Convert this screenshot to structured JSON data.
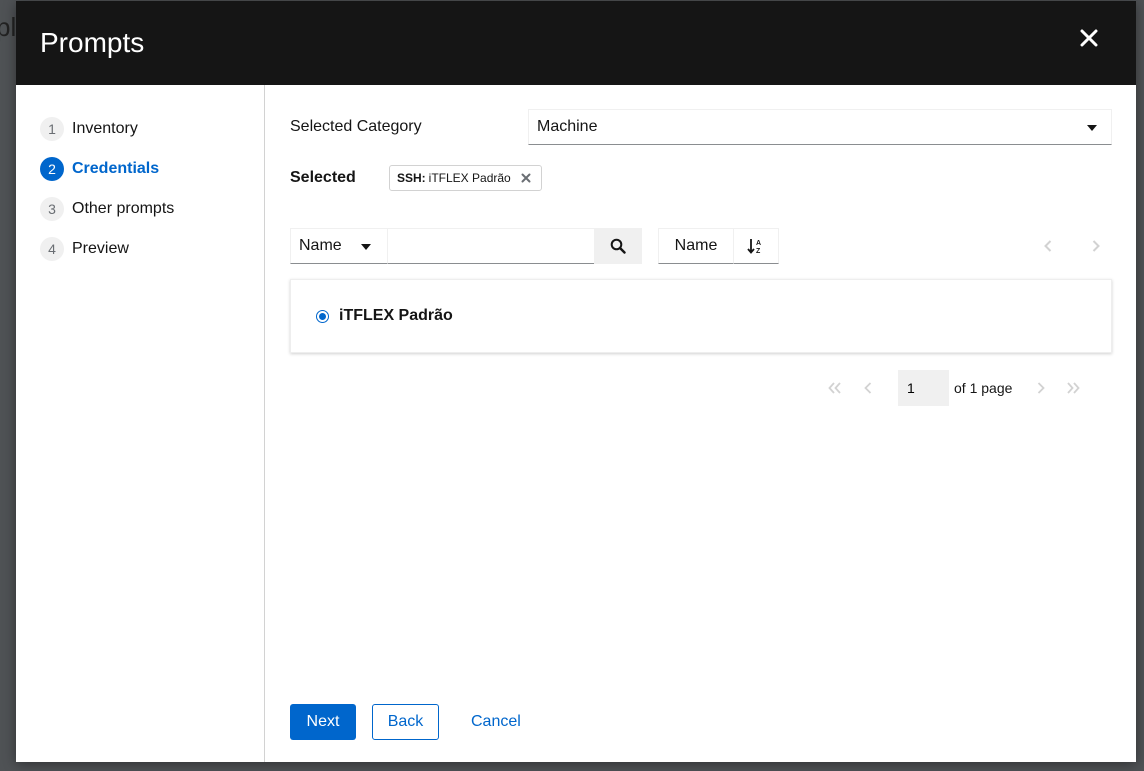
{
  "background": {
    "fragment": "pl"
  },
  "modal": {
    "title": "Prompts",
    "close_icon": "close-icon"
  },
  "nav": {
    "items": [
      {
        "num": "1",
        "label": "Inventory",
        "current": false
      },
      {
        "num": "2",
        "label": "Credentials",
        "current": true
      },
      {
        "num": "3",
        "label": "Other prompts",
        "current": false
      },
      {
        "num": "4",
        "label": "Preview",
        "current": false
      }
    ]
  },
  "category": {
    "label": "Selected Category",
    "value": "Machine"
  },
  "selected": {
    "label": "Selected",
    "chip_prefix": "SSH:",
    "chip_value": "iTFLEX Padrão"
  },
  "toolbar": {
    "filter_type": "Name",
    "search_placeholder": "",
    "sort_by": "Name",
    "search_icon": "search-icon",
    "sort_icon": "sort-alpha-down-icon"
  },
  "list": {
    "items": [
      {
        "label": "iTFLEX Padrão",
        "selected": true
      }
    ]
  },
  "pagination": {
    "page": "1",
    "of_text": "of 1 page"
  },
  "footer": {
    "next_label": "Next",
    "back_label": "Back",
    "cancel_label": "Cancel"
  },
  "colors": {
    "accent": "#0066cc",
    "header_bg": "#151515"
  }
}
